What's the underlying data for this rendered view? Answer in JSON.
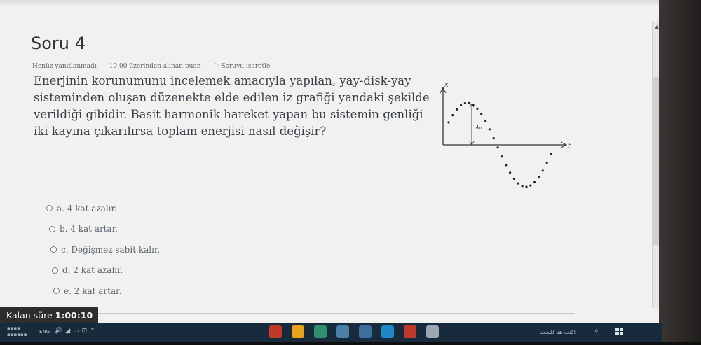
{
  "question": {
    "title": "Soru 4",
    "status": "Henüz yanıtlanmadı",
    "points": "10.00 üzerinden alınan puan",
    "flag_label": "Soruyu işaretle",
    "text": "Enerjinin korunumunu incelemek amacıyla yapılan, yay-disk-yay sisteminden oluşan düzenekte elde edilen iz grafiği yandaki şekilde verildiği gibidir. Basit harmonik hareket yapan bu sistemin genliği iki kayına çıkarılırsa toplam enerjisi nasıl değişir?"
  },
  "graph": {
    "y_axis_label": "x",
    "x_axis_label": "t",
    "amplitude_label": "A₀"
  },
  "options": [
    {
      "label": "a. 4 kat azalır."
    },
    {
      "label": "b. 4 kat artar."
    },
    {
      "label": "c. Değişmez sabit kalır."
    },
    {
      "label": "d. 2 kat azalır."
    },
    {
      "label": "e. 2 kat artar."
    }
  ],
  "timer": {
    "label": "Kalan süre",
    "value": "1:00:10"
  },
  "taskbar": {
    "lang": "ENG",
    "search_text": "اكتب هنا للبحث",
    "colors": {
      "background": "#182b3c",
      "app_icons": [
        "#c0392b",
        "#e8a21c",
        "#2f8f6f",
        "#4a7fa8",
        "#3d6e9c",
        "#1e88c8",
        "#c0392b",
        "#9aa7b2"
      ]
    },
    "app_icon_names": [
      "opera-icon",
      "chrome-icon",
      "app-icon",
      "store-icon",
      "folder-icon",
      "edge-icon",
      "acrobat-icon",
      "taskview-icon"
    ]
  }
}
